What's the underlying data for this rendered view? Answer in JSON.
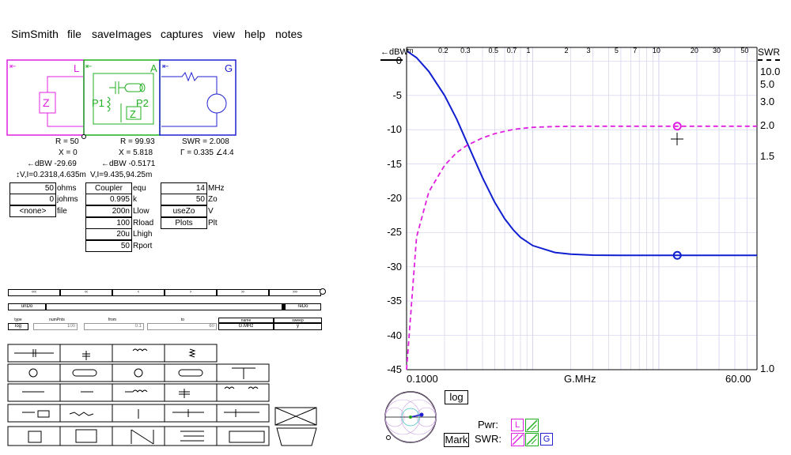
{
  "menu": {
    "items": [
      "SimSmith",
      "file",
      "saveImages",
      "captures",
      "view",
      "help",
      "notes"
    ]
  },
  "schematic": {
    "L_label": "L",
    "A_label": "A",
    "G_label": "G",
    "L_Z": "Z",
    "A_Z": "Z",
    "P1": "P1",
    "P2": "P2",
    "arrow": "⇤"
  },
  "readouts": {
    "load": {
      "r": "R = 50",
      "x": "X = 0",
      "dbw": "←dBW -29.69",
      "vi": "↕V,I=0.2318,4.635m"
    },
    "node": {
      "r": "R = 99.93",
      "x": "X = 5.818",
      "dbw": "←dBW -0.5171",
      "vi": "V,I=9.435,94.25m"
    },
    "gen": {
      "swr": "SWR = 2.008",
      "gamma": "Γ = 0.335 ∠4.4"
    }
  },
  "load_params": [
    {
      "value": "50",
      "unit": "ohms"
    },
    {
      "value": "0",
      "unit": "johms"
    },
    {
      "value": "<none>",
      "unit": "file"
    }
  ],
  "coupler_params": [
    {
      "value": "Coupler",
      "unit": "equ"
    },
    {
      "value": "0.995",
      "unit": "k"
    },
    {
      "value": "200n",
      "unit": "Llow"
    },
    {
      "value": "100",
      "unit": "Rload"
    },
    {
      "value": "20u",
      "unit": "Lhigh"
    },
    {
      "value": "50",
      "unit": "Rport"
    }
  ],
  "gen_params": [
    {
      "value": "14",
      "unit": "MHz"
    },
    {
      "value": "50",
      "unit": "Zo"
    },
    {
      "value": "useZo",
      "unit": "V"
    },
    {
      "value": "Plots",
      "unit": "Plt"
    }
  ],
  "undo": {
    "left": "unDo",
    "right": "reDo"
  },
  "sweep": {
    "headers": [
      "type",
      "numPnts",
      "from",
      "to",
      "name",
      "sweep"
    ],
    "values": [
      "log",
      "100",
      "0.1",
      "60",
      "G.MHz",
      "y"
    ]
  },
  "plot": {
    "left_axis_title": "←dBW",
    "right_axis_title": "SWR",
    "x_axis_name": "G.MHz",
    "x_start": "0.1000",
    "x_end": "60.00",
    "log_button": "log",
    "mark_button": "Mark",
    "pwr_label": "Pwr:",
    "swr_label": "SWR:",
    "check_L": "L",
    "check_G": "G",
    "top_ticks": [
      "m",
      "0.2",
      "0.3",
      "0.5",
      "0.7",
      "1",
      "2",
      "3",
      "5",
      "7",
      "10",
      "20",
      "30",
      "50"
    ],
    "left_ticks": [
      "0",
      "-5",
      "-10",
      "-15",
      "-20",
      "-25",
      "-30",
      "-35",
      "-40",
      "-45"
    ],
    "right_ticks": [
      "10.0",
      "5.0",
      "3.0",
      "2.0",
      "1.5",
      "1.0"
    ],
    "colors": {
      "dbw": "#1020d0",
      "swr": "#e020e0",
      "grid": "#d8d8f0"
    }
  },
  "chart_data": {
    "type": "line",
    "xscale": "log",
    "xlim": [
      0.1,
      60
    ],
    "ylim_left": [
      -45,
      2
    ],
    "y2lim_swr": [
      1.0,
      20.0
    ],
    "series": [
      {
        "x": [
          0.1,
          0.12,
          0.15,
          0.2,
          0.25,
          0.3,
          0.4,
          0.5,
          0.6,
          0.7,
          0.8,
          1.0,
          1.5,
          2,
          3,
          5,
          7,
          10,
          14,
          20,
          30,
          60
        ],
        "values": [
          1.5,
          0.5,
          -1.5,
          -5,
          -8.5,
          -11.8,
          -17,
          -20.6,
          -23,
          -24.6,
          -25.7,
          -26.9,
          -27.9,
          -28.15,
          -28.3,
          -28.33,
          -28.33,
          -28.33,
          -28.33,
          -28.33,
          -28.33,
          -28.33
        ]
      },
      {
        "x": [
          0.1,
          0.12,
          0.15,
          0.2,
          0.25,
          0.3,
          0.4,
          0.5,
          0.6,
          0.7,
          0.8,
          1.0,
          1.5,
          2,
          3,
          5,
          7,
          10,
          14,
          20,
          30,
          60
        ],
        "values": [
          1.0,
          1.11,
          1.25,
          1.42,
          1.55,
          1.64,
          1.76,
          1.84,
          1.89,
          1.93,
          1.95,
          1.98,
          2.0,
          2.005,
          2.008,
          2.008,
          2.008,
          2.008,
          2.008,
          2.008,
          2.008,
          2.008
        ]
      }
    ],
    "marker_x": 14
  }
}
